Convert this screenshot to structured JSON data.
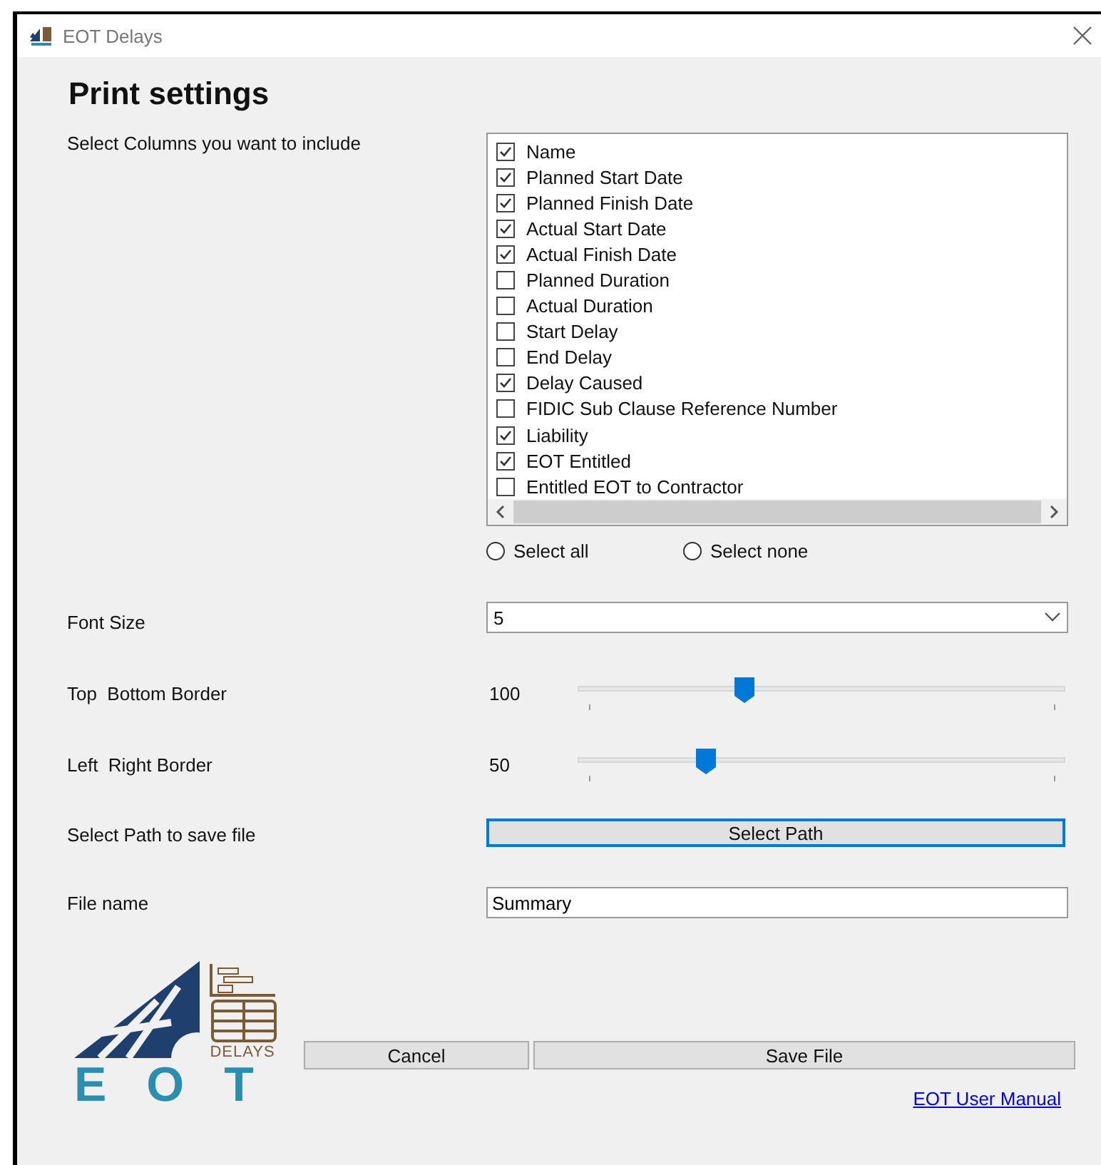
{
  "window": {
    "title": "EOT Delays"
  },
  "heading": "Print settings",
  "columns_label": "Select Columns you want to include",
  "columns": [
    {
      "label": "Name",
      "checked": true
    },
    {
      "label": "Planned Start Date",
      "checked": true
    },
    {
      "label": "Planned Finish Date",
      "checked": true
    },
    {
      "label": "Actual Start Date",
      "checked": true
    },
    {
      "label": "Actual Finish Date",
      "checked": true
    },
    {
      "label": "Planned Duration",
      "checked": false
    },
    {
      "label": "Actual Duration",
      "checked": false
    },
    {
      "label": "Start Delay",
      "checked": false
    },
    {
      "label": "End Delay",
      "checked": false
    },
    {
      "label": "Delay Caused",
      "checked": true
    },
    {
      "label": "FIDIC Sub Clause Reference Number",
      "checked": false
    },
    {
      "label": "Liability",
      "checked": true
    },
    {
      "label": "EOT Entitled",
      "checked": true
    },
    {
      "label": "Entitled EOT to Contractor",
      "checked": false
    }
  ],
  "selection_radios": [
    {
      "label": "Select all",
      "selected": false
    },
    {
      "label": "Select none",
      "selected": false
    }
  ],
  "font_size": {
    "label": "Font Size",
    "value": "5"
  },
  "sliders": [
    {
      "label": "Top  Bottom Border",
      "reading": "100",
      "level": 0.335
    },
    {
      "label": "Left  Right Border",
      "reading": "50",
      "level": 0.25
    }
  ],
  "path": {
    "label": "Select Path to save file",
    "button": "Select Path"
  },
  "file_name": {
    "label": "File name",
    "value": "Summary"
  },
  "logo": {
    "subtitle": "DELAYS",
    "name": "EOT"
  },
  "buttons": [
    {
      "label": "Cancel"
    },
    {
      "label": "Save File"
    }
  ],
  "manual_link": "EOT User Manual"
}
